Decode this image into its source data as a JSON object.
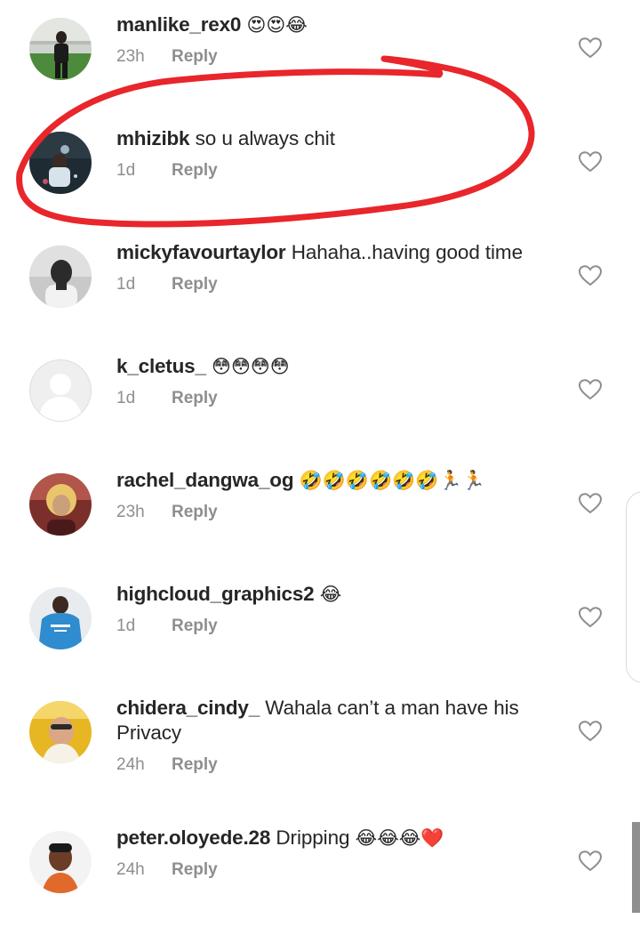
{
  "comments": [
    {
      "username": "manlike_rex0",
      "text": "",
      "emoji": "😍😍😂",
      "time": "23h",
      "reply_label": "Reply",
      "avatar_icon": "profile-photo"
    },
    {
      "username": "mhizibk",
      "text": "so u always chit",
      "emoji": "",
      "time": "1d",
      "reply_label": "Reply",
      "avatar_icon": "profile-photo"
    },
    {
      "username": "mickyfavourtaylor",
      "text": "Hahaha..having good time",
      "emoji": "",
      "time": "1d",
      "reply_label": "Reply",
      "avatar_icon": "profile-photo"
    },
    {
      "username": "k_cletus_",
      "text": "",
      "emoji": "😳😳😳😳",
      "time": "1d",
      "reply_label": "Reply",
      "avatar_icon": "default-avatar"
    },
    {
      "username": "rachel_dangwa_og",
      "text": "",
      "emoji": "🤣🤣🤣🤣🤣🤣🏃🏃",
      "time": "23h",
      "reply_label": "Reply",
      "avatar_icon": "profile-photo"
    },
    {
      "username": "highcloud_graphics2",
      "text": "",
      "emoji": "😂",
      "time": "1d",
      "reply_label": "Reply",
      "avatar_icon": "profile-photo"
    },
    {
      "username": "chidera_cindy_",
      "text": "Wahala can’t a man have his Privacy",
      "emoji": "",
      "time": "24h",
      "reply_label": "Reply",
      "avatar_icon": "profile-photo"
    },
    {
      "username": "peter.oloyede.28",
      "text": "Dripping",
      "emoji": "😂😂😂❤️",
      "time": "24h",
      "reply_label": "Reply",
      "avatar_icon": "profile-photo"
    }
  ],
  "colors": {
    "text": "#262626",
    "meta": "#8e8e8e",
    "annotation": "#e8262b",
    "heart_outline": "#8e8e8e"
  }
}
